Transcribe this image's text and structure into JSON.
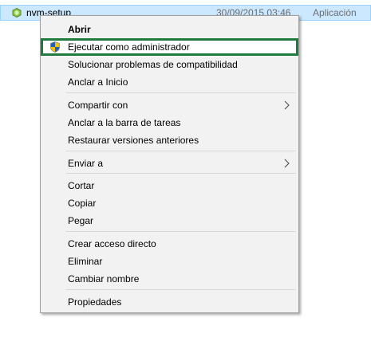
{
  "file": {
    "name": "nvm-setup",
    "date": "30/09/2015 03:46",
    "type": "Aplicación"
  },
  "menu": {
    "open": "Abrir",
    "run_as_admin": "Ejecutar como administrador",
    "troubleshoot": "Solucionar problemas de compatibilidad",
    "pin_start": "Anclar a Inicio",
    "share_with": "Compartir con",
    "pin_taskbar": "Anclar a la barra de tareas",
    "restore_versions": "Restaurar versiones anteriores",
    "send_to": "Enviar a",
    "cut": "Cortar",
    "copy": "Copiar",
    "paste": "Pegar",
    "create_shortcut": "Crear acceso directo",
    "delete": "Eliminar",
    "rename": "Cambiar nombre",
    "properties": "Propiedades"
  },
  "colors": {
    "selection_bg": "#cce8ff",
    "highlight_border": "#1e7a3d",
    "menu_bg": "#f2f2f2"
  },
  "icons": {
    "file": "setup-app-icon",
    "admin": "uac-shield-icon",
    "submenu": "chevron-right-icon"
  }
}
